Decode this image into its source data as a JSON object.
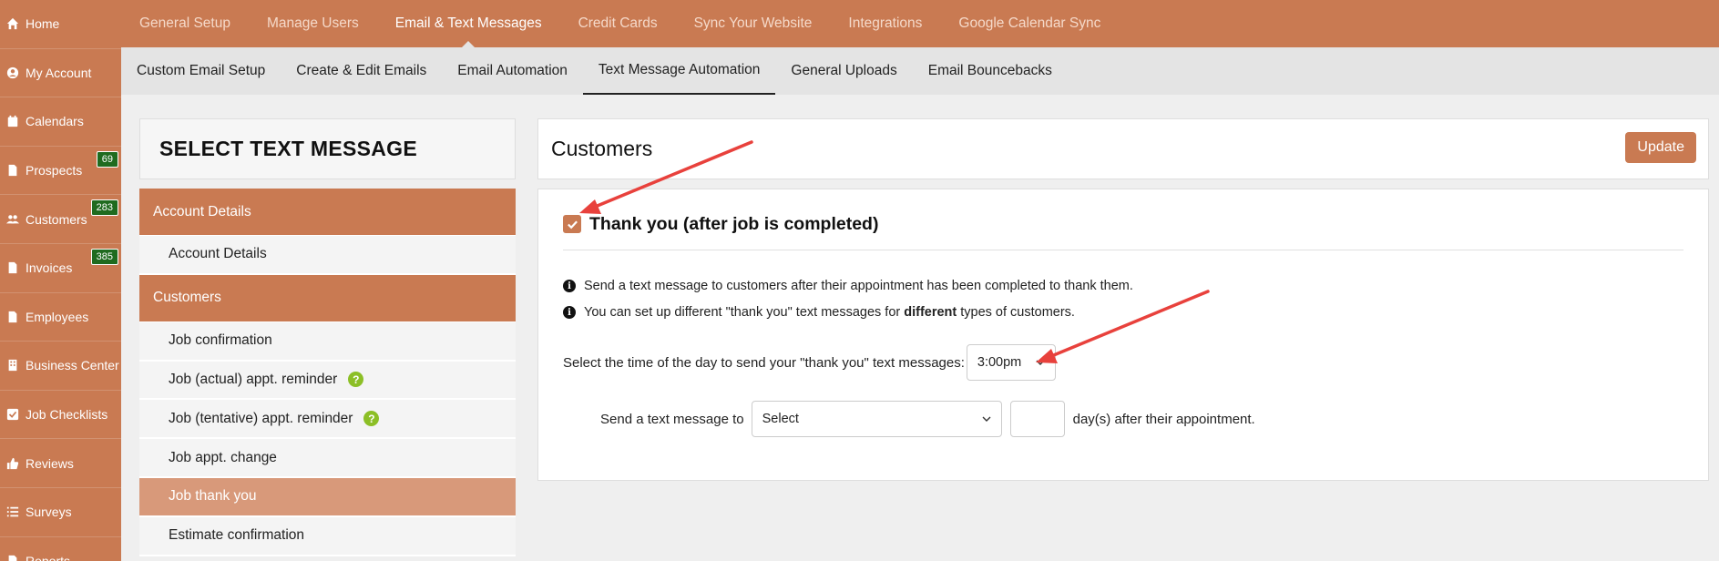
{
  "sidebar": {
    "items": [
      {
        "label": "Home",
        "icon": "home-icon"
      },
      {
        "label": "My Account",
        "icon": "user-circle-icon"
      },
      {
        "label": "Calendars",
        "icon": "calendar-icon"
      },
      {
        "label": "Prospects",
        "icon": "document-icon",
        "badge": "69"
      },
      {
        "label": "Customers",
        "icon": "users-icon",
        "badge": "283"
      },
      {
        "label": "Invoices",
        "icon": "document-icon",
        "badge": "385"
      },
      {
        "label": "Employees",
        "icon": "document-icon"
      },
      {
        "label": "Business Center",
        "icon": "building-icon"
      },
      {
        "label": "Job Checklists",
        "icon": "check-square-icon"
      },
      {
        "label": "Reviews",
        "icon": "thumbs-up-icon"
      },
      {
        "label": "Surveys",
        "icon": "list-icon"
      },
      {
        "label": "Reports",
        "icon": "document-icon"
      }
    ]
  },
  "topnav": {
    "items": [
      "General Setup",
      "Manage Users",
      "Email & Text Messages",
      "Credit Cards",
      "Sync Your Website",
      "Integrations",
      "Google Calendar Sync"
    ],
    "active": "Email & Text Messages"
  },
  "subnav": {
    "items": [
      "Custom Email Setup",
      "Create & Edit Emails",
      "Email Automation",
      "Text Message Automation",
      "General Uploads",
      "Email Bouncebacks"
    ],
    "active": "Text Message Automation"
  },
  "left_panel": {
    "title": "SELECT TEXT MESSAGE",
    "groups": [
      {
        "label": "Account Details",
        "items": [
          {
            "label": "Account Details"
          }
        ]
      },
      {
        "label": "Customers",
        "items": [
          {
            "label": "Job confirmation"
          },
          {
            "label": "Job (actual) appt. reminder",
            "help": "?"
          },
          {
            "label": "Job (tentative) appt. reminder",
            "help": "?"
          },
          {
            "label": "Job appt. change"
          },
          {
            "label": "Job thank you",
            "active": true
          },
          {
            "label": "Estimate confirmation"
          }
        ]
      }
    ]
  },
  "content": {
    "title": "Customers",
    "update_label": "Update",
    "checkbox_label": "Thank you (after job is completed)",
    "checkbox_checked": true,
    "info1": "Send a text message to customers after their appointment has been completed to thank them.",
    "info2_pre": "You can set up different \"thank you\" text messages for",
    "info2_bold": "different",
    "info2_post": "types of customers.",
    "time_label": "Select the time of the day to send your \"thank you\" text messages:",
    "time_value": "3:00pm",
    "send_label": "Send a text message to",
    "send_select_value": "Select",
    "days_value": "",
    "days_suffix": "day(s) after their appointment."
  },
  "colors": {
    "brand": "#c97a52",
    "active_menu": "#d8997a",
    "badge": "#1f6b1f",
    "help": "#8cbf26",
    "arrow": "#e8413c"
  }
}
